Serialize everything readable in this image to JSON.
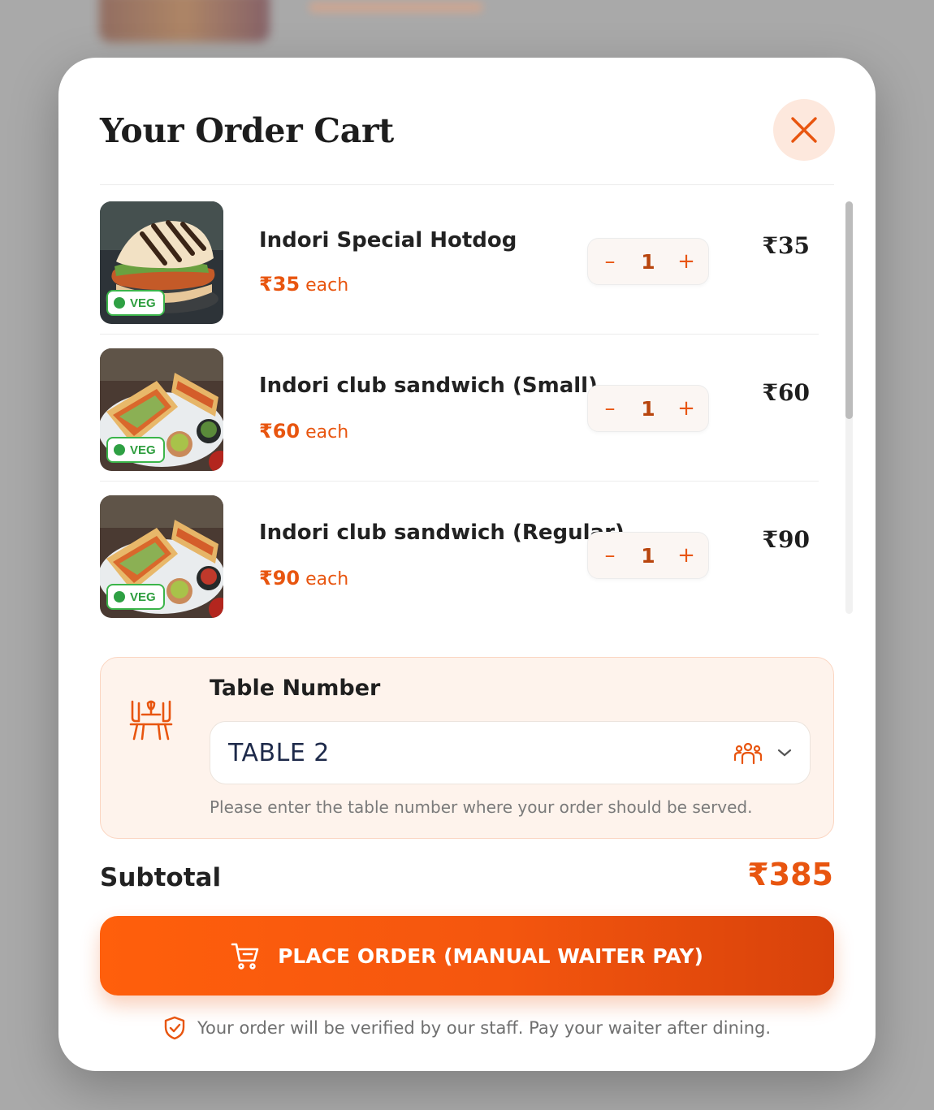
{
  "modal": {
    "title": "Your Order Cart",
    "close_label": "×"
  },
  "cart": {
    "items": [
      {
        "name": "Indori Special Hotdog",
        "unit_price": "₹35",
        "unit_suffix": "each",
        "qty": "1",
        "total": "₹35",
        "veg_label": "VEG",
        "image": "hotdog"
      },
      {
        "name": "Indori club sandwich (Small)",
        "unit_price": "₹60",
        "unit_suffix": "each",
        "qty": "1",
        "total": "₹60",
        "veg_label": "VEG",
        "image": "sandwich"
      },
      {
        "name": "Indori club sandwich (Regular)",
        "unit_price": "₹90",
        "unit_suffix": "each",
        "qty": "1",
        "total": "₹90",
        "veg_label": "VEG",
        "image": "sandwich"
      }
    ],
    "decrement_symbol": "–",
    "increment_symbol": "+"
  },
  "table": {
    "label": "Table Number",
    "selected": "TABLE 2",
    "help_text": "Please enter the table number where your order should be served."
  },
  "summary": {
    "subtotal_label": "Subtotal",
    "subtotal_value": "₹385"
  },
  "actions": {
    "place_order_label": "PLACE ORDER (MANUAL WAITER PAY)"
  },
  "footer": {
    "note": "Your order will be verified by our staff. Pay your waiter after dining."
  },
  "icons": {
    "close": "close-icon",
    "table": "dining-table-icon",
    "people": "people-icon",
    "chevron": "chevron-down-icon",
    "cart": "cart-icon",
    "shield": "shield-check-icon"
  },
  "colors": {
    "accent": "#e8550f",
    "accent_light": "#fef3ec",
    "veg": "#2ea043"
  }
}
